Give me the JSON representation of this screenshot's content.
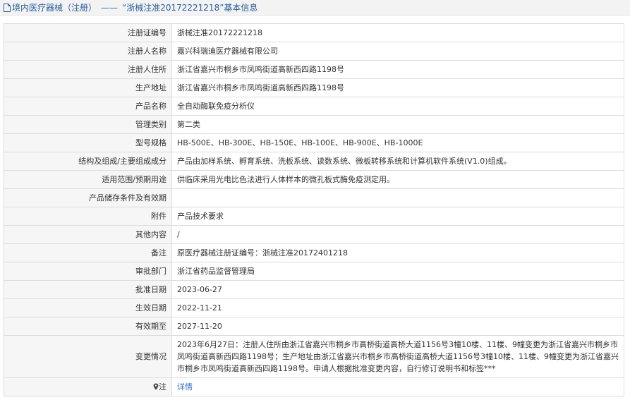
{
  "header": {
    "category": "境内医疗器械（注册）",
    "separator": "——",
    "title": "“浙械注准20172221218”基本信息"
  },
  "rows": [
    {
      "label": "注册证编号",
      "value": "浙械注准20172221218"
    },
    {
      "label": "注册人名称",
      "value": "嘉兴科瑞迪医疗器械有限公司"
    },
    {
      "label": "注册人住所",
      "value": "浙江省嘉兴市桐乡市凤鸣街道高新西四路1198号"
    },
    {
      "label": "生产地址",
      "value": "浙江省嘉兴市桐乡市凤鸣街道高新西四路1198号"
    },
    {
      "label": "产品名称",
      "value": "全自动酶联免疫分析仪"
    },
    {
      "label": "管理类别",
      "value": "第二类"
    },
    {
      "label": "型号规格",
      "value": "HB-500E、HB-300E、HB-150E、HB-100E、HB-900E、HB-1000E"
    },
    {
      "label": "结构及组成/主要组成成分",
      "value": "产品由加样系统、孵育系统、洗板系统、读数系统、微板转移系统和计算机软件系统(V1.0)组成。"
    },
    {
      "label": "适用范围/预期用途",
      "value": "供临床采用光电比色法进行人体样本的微孔板式酶免疫测定用。"
    },
    {
      "label": "产品储存条件及有效期",
      "value": ""
    },
    {
      "label": "附件",
      "value": "产品技术要求"
    },
    {
      "label": "其他内容",
      "value": "/"
    },
    {
      "label": "备注",
      "value": "原医疗器械注册证编号：浙械注准20172401218"
    },
    {
      "label": "审批部门",
      "value": "浙江省药品监督管理局"
    },
    {
      "label": "批准日期",
      "value": "2023-06-27"
    },
    {
      "label": "生效日期",
      "value": "2022-11-21"
    },
    {
      "label": "有效期至",
      "value": "2027-11-20"
    },
    {
      "label": "变更情况",
      "value": "2023年6月27日：注册人住所由浙江省嘉兴市桐乡市高桥街道高桥大道1156号3幢10楼、11楼、9幢变更为浙江省嘉兴市桐乡市凤鸣街道高新西四路1198号；生产地址由浙江省嘉兴市桐乡市高桥街道高桥大道1156号3幢10楼、11楼、9幢变更为浙江省嘉兴市桐乡市凤鸣街道高新西四路1198号。申请人根据批准变更内容，自行修订说明书和标签***"
    }
  ],
  "note": {
    "label": "注",
    "link": "详情",
    "icon": "map-pin-icon"
  },
  "colors": {
    "title": "#2a5d9a",
    "link": "#2a6fc9",
    "label_bg": "#f6f6f6",
    "border": "#dcdcdc"
  }
}
